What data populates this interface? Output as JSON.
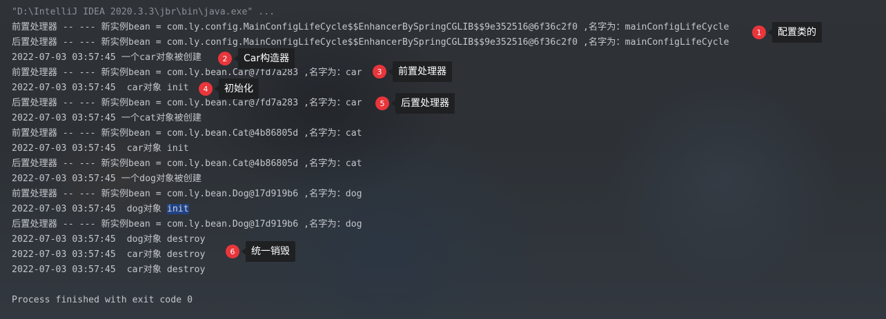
{
  "console": {
    "lines": [
      {
        "text": "\"D:\\IntelliJ IDEA 2020.3.3\\jbr\\bin\\java.exe\" ..."
      },
      {
        "text": "前置处理器 -- --- 新实例bean = com.ly.config.MainConfigLifeCycle$$EnhancerBySpringCGLIB$$9e352516@6f36c2f0 ,名字为：mainConfigLifeCycle"
      },
      {
        "text": "后置处理器 -- --- 新实例bean = com.ly.config.MainConfigLifeCycle$$EnhancerBySpringCGLIB$$9e352516@6f36c2f0 ,名字为：mainConfigLifeCycle"
      },
      {
        "text": "2022-07-03 03:57:45 一个car对象被创建"
      },
      {
        "text": "前置处理器 -- --- 新实例bean = com.ly.bean.Car@7fd7a283 ,名字为：car"
      },
      {
        "text": "2022-07-03 03:57:45  car对象 init"
      },
      {
        "text": "后置处理器 -- --- 新实例bean = com.ly.bean.Car@7fd7a283 ,名字为：car"
      },
      {
        "text": "2022-07-03 03:57:45 一个cat对象被创建"
      },
      {
        "text": "前置处理器 -- --- 新实例bean = com.ly.bean.Cat@4b86805d ,名字为：cat"
      },
      {
        "text": "2022-07-03 03:57:45  car对象 init"
      },
      {
        "text": "后置处理器 -- --- 新实例bean = com.ly.bean.Cat@4b86805d ,名字为：cat"
      },
      {
        "text": "2022-07-03 03:57:45 一个dog对象被创建"
      },
      {
        "text": "前置处理器 -- --- 新实例bean = com.ly.bean.Dog@17d919b6 ,名字为：dog"
      },
      {
        "text": "2022-07-03 03:57:45  dog对象 ",
        "highlight": "init"
      },
      {
        "text": "后置处理器 -- --- 新实例bean = com.ly.bean.Dog@17d919b6 ,名字为：dog"
      },
      {
        "text": "2022-07-03 03:57:45  dog对象 destroy"
      },
      {
        "text": "2022-07-03 03:57:45  car对象 destroy"
      },
      {
        "text": "2022-07-03 03:57:45  car对象 destroy"
      },
      {
        "text": ""
      },
      {
        "text": "Process finished with exit code 0"
      }
    ]
  },
  "annotations": [
    {
      "num": "1",
      "label": "配置类的"
    },
    {
      "num": "2",
      "label": "Car构造器"
    },
    {
      "num": "3",
      "label": "前置处理器"
    },
    {
      "num": "4",
      "label": "初始化"
    },
    {
      "num": "5",
      "label": "后置处理器"
    },
    {
      "num": "6",
      "label": "统一销毁"
    }
  ],
  "colors": {
    "console_text": "#c4c7cc",
    "command_text": "#8b9199",
    "badge": "#e8363b",
    "label_bg": "#1f2022",
    "selection": "#214283"
  }
}
